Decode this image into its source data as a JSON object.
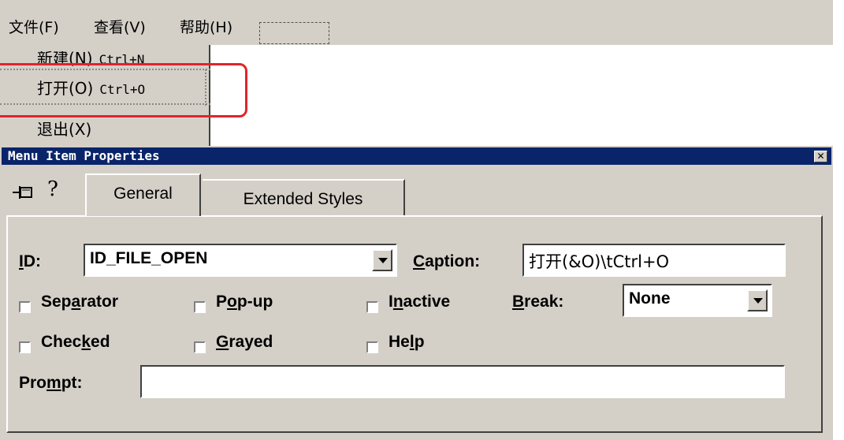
{
  "menubar": {
    "file": "文件(F)",
    "view": "查看(V)",
    "help": "帮助(H)"
  },
  "dropdown": {
    "new_zh": "新建(N)",
    "new_key": "Ctrl+N",
    "open_zh": "打开(O)",
    "open_key": "Ctrl+O",
    "exit_zh": "退出(X)"
  },
  "dialog": {
    "title": "Menu Item Properties",
    "close": "✕",
    "tabs": [
      "General",
      "Extended Styles"
    ],
    "id_label": "ID:",
    "id_value": "ID_FILE_OPEN",
    "caption_label": "Caption:",
    "caption_value": "打开(&O)\\tCtrl+O",
    "checkboxes": [
      "Separator",
      "Pop-up",
      "Inactive",
      "Checked",
      "Grayed",
      "Help"
    ],
    "break_label": "Break:",
    "break_value": "None",
    "prompt_label": "Prompt:",
    "prompt_value": ""
  },
  "colors": {
    "face": "#d4d0c8",
    "title_bar": "#0a246a",
    "highlight": "#e0242b"
  }
}
